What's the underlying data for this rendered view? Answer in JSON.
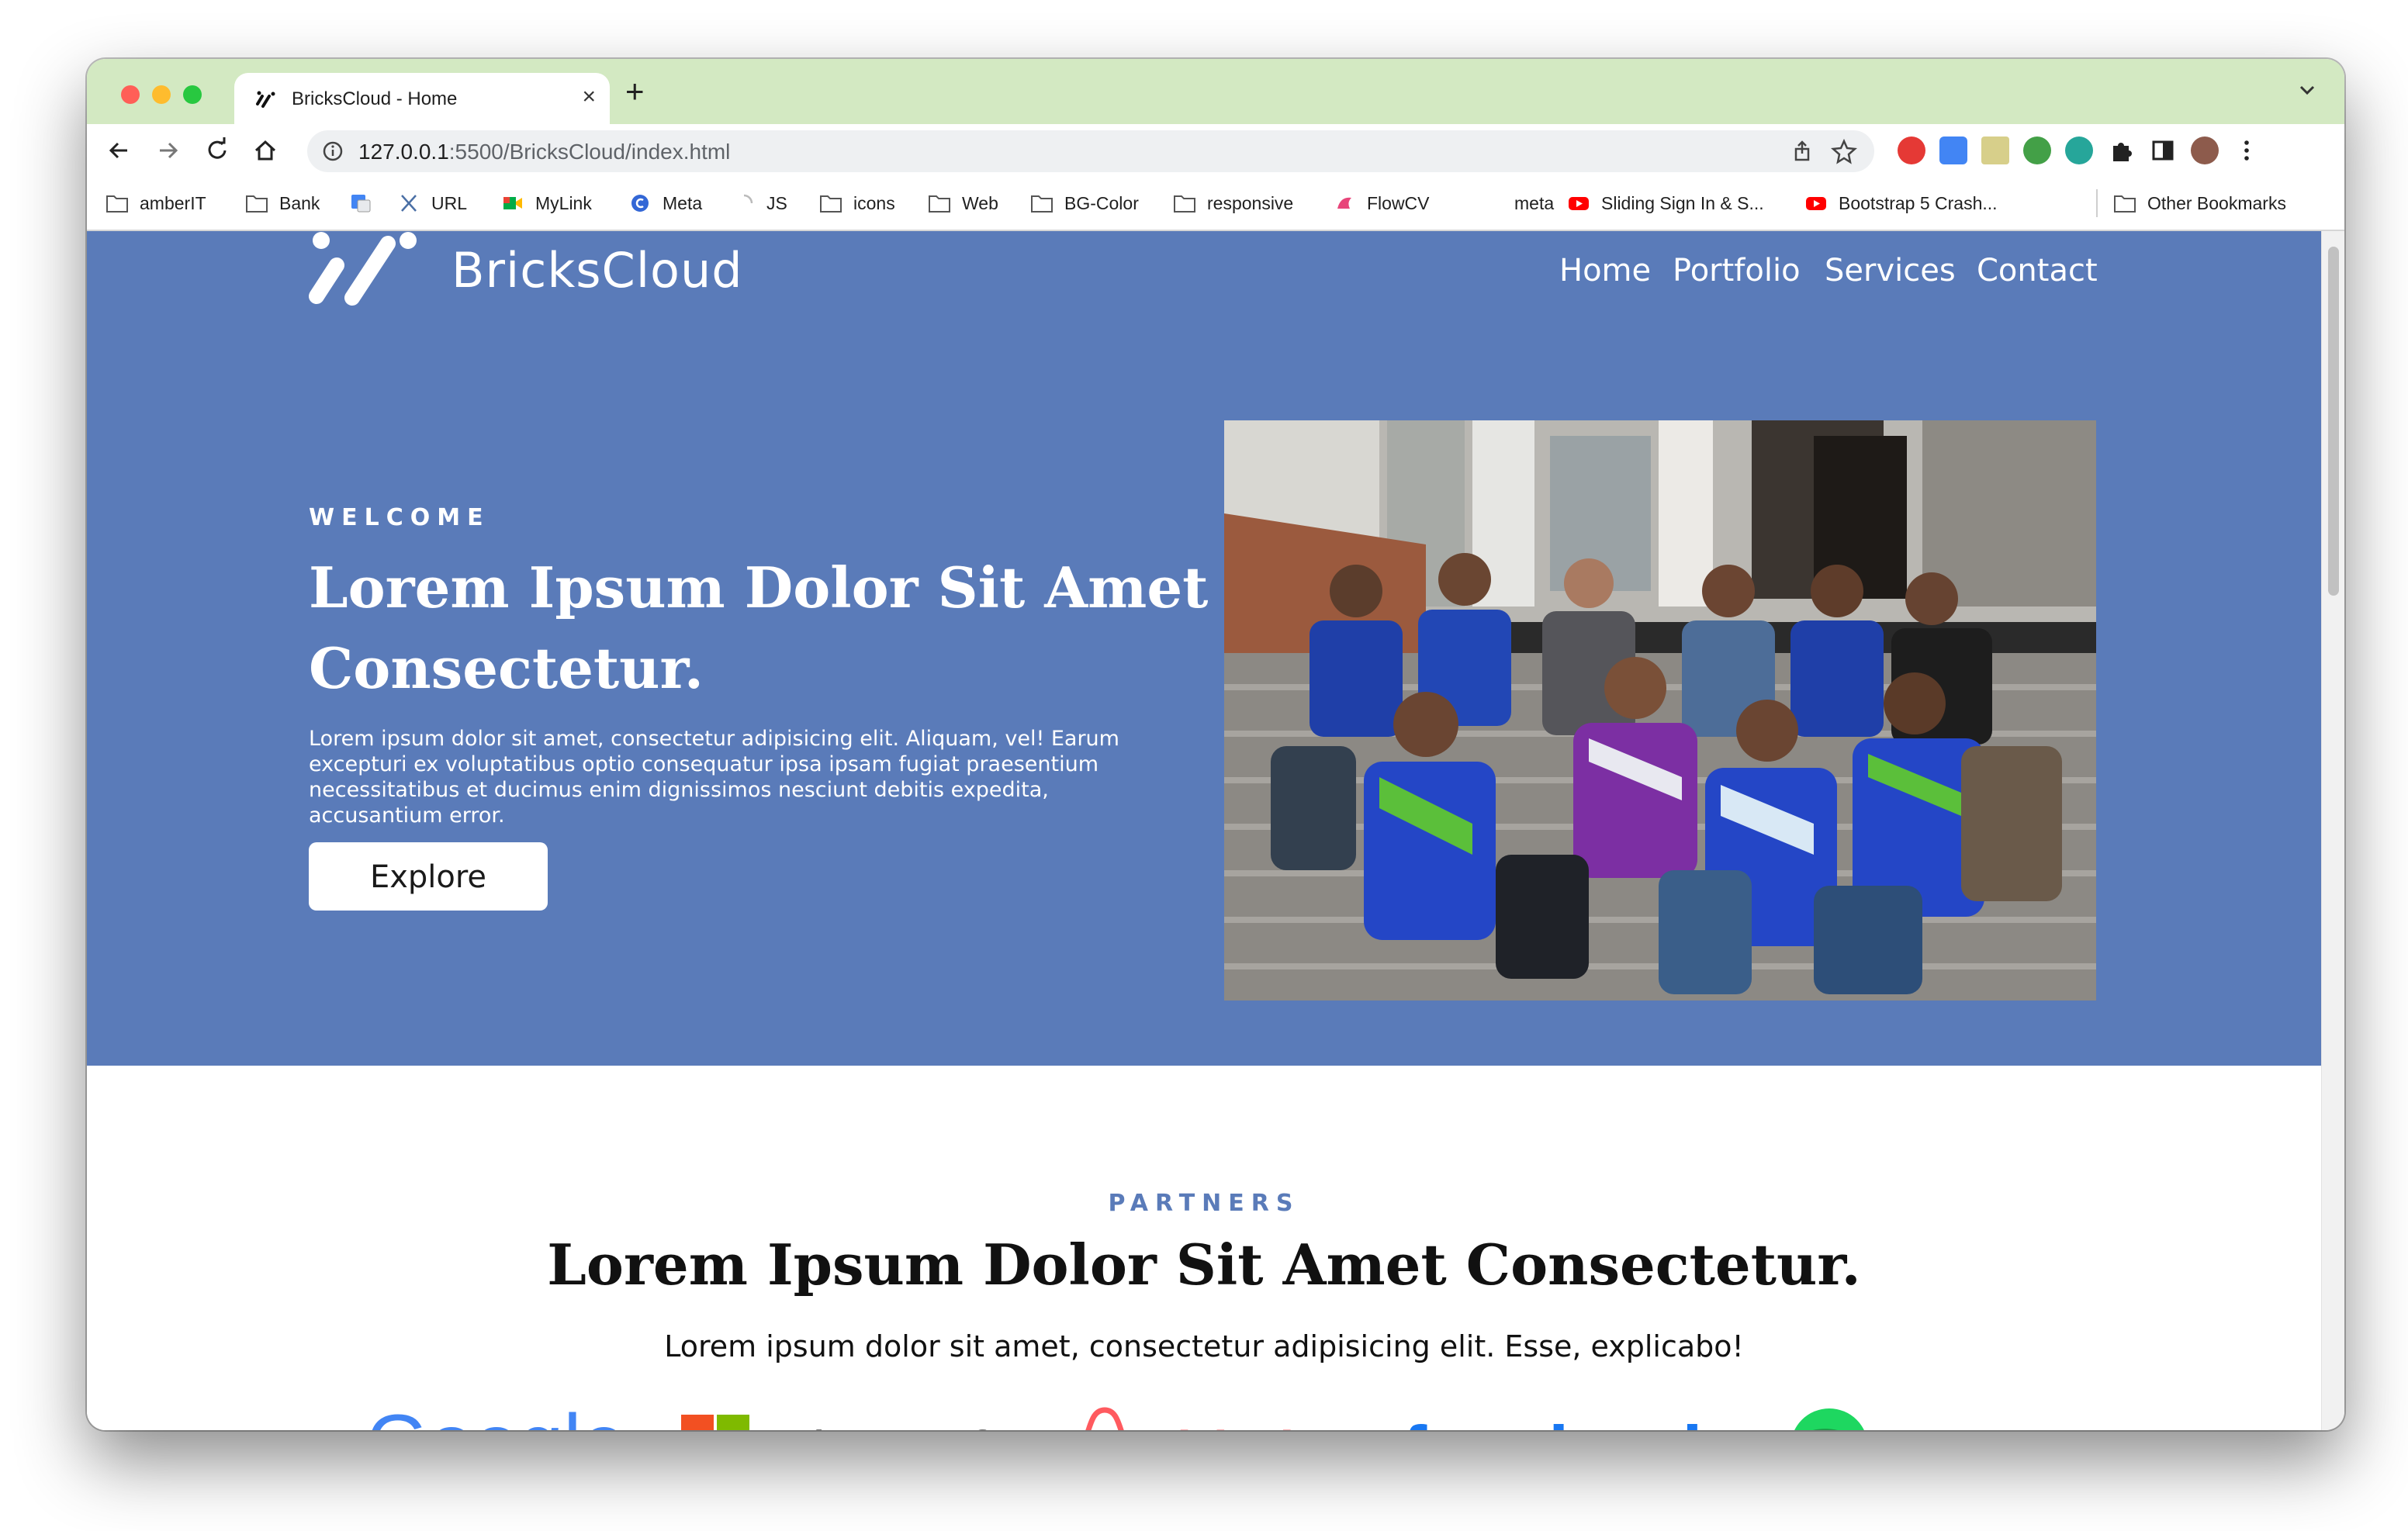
{
  "browser": {
    "tab_title": "BricksCloud - Home",
    "url_host": "127.0.0.1",
    "url_path": ":5500/BricksCloud/index.html",
    "bookmarks": [
      "amberIT",
      "Bank",
      "URL",
      "MyLink",
      "Meta",
      "JS",
      "icons",
      "Web",
      "BG-Color",
      "responsive",
      "FlowCV",
      "meta",
      "Sliding Sign In & S...",
      "Bootstrap 5 Crash...",
      "Other Bookmarks"
    ]
  },
  "site": {
    "brand": "BricksCloud",
    "nav": [
      "Home",
      "Portfolio",
      "Services",
      "Contact"
    ],
    "accent": "#5a7bb9"
  },
  "hero": {
    "eyebrow": "WELCOME",
    "title": "Lorem Ipsum Dolor Sit Amet Consectetur.",
    "text": "Lorem ipsum dolor sit amet, consectetur adipisicing elit. Aliquam, vel! Earum excepturi ex voluptatibus optio consequatur ipsa ipsam fugiat praesentium necessitatibus et ducimus enim dignissimos nesciunt debitis expedita, accusantium error.",
    "button": "Explore"
  },
  "partners": {
    "eyebrow": "PARTNERS",
    "title": "Lorem Ipsum Dolor Sit Amet Consectetur.",
    "text": "Lorem ipsum dolor sit amet, consectetur adipisicing elit. Esse, explicabo!",
    "logos": [
      "Google",
      "Microsoft",
      "airbnb",
      "facebook",
      "Spotify"
    ]
  }
}
